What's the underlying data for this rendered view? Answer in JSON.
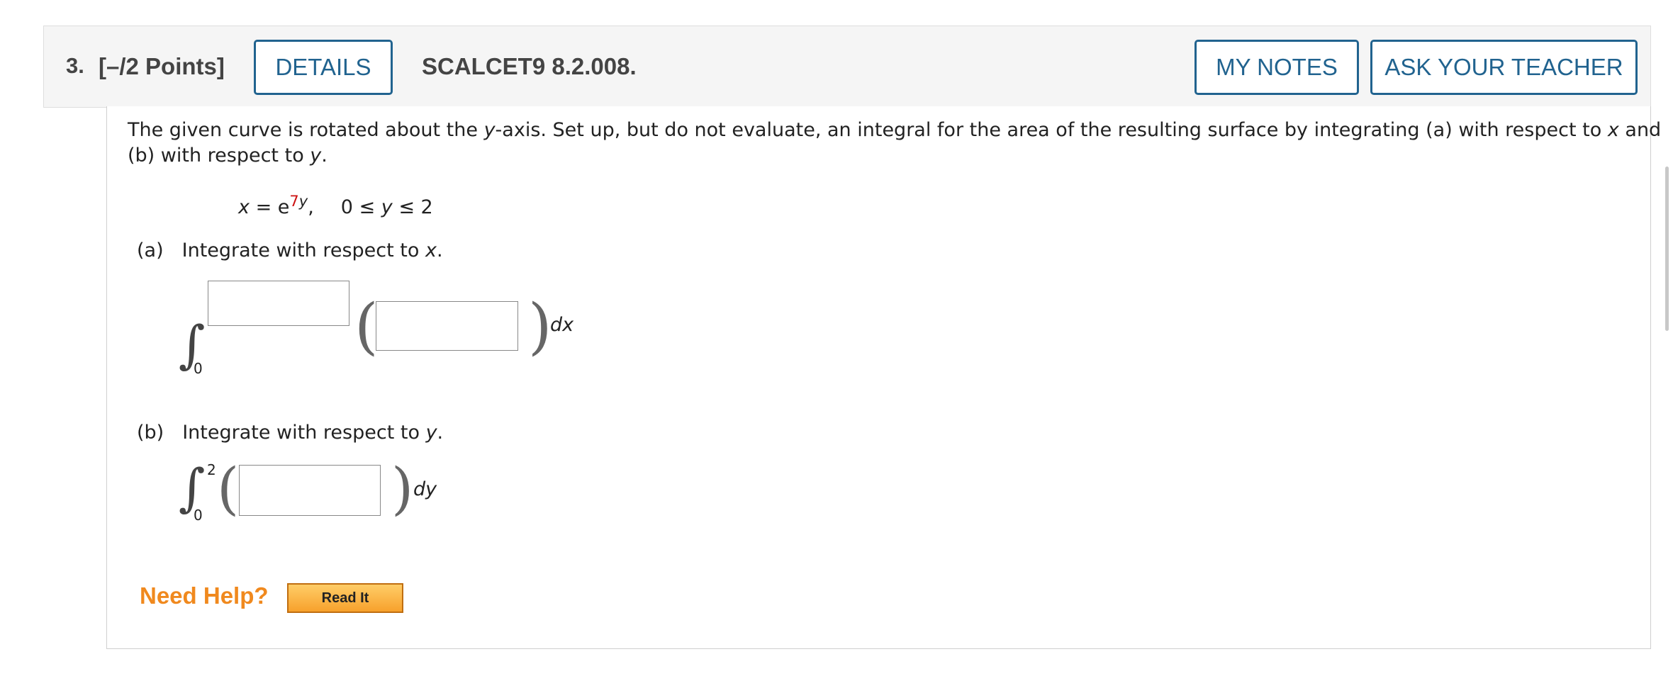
{
  "header": {
    "question_number": "3.",
    "points": "[–/2 Points]",
    "details_label": "DETAILS",
    "code": "SCALCET9 8.2.008.",
    "my_notes_label": "MY NOTES",
    "ask_teacher_label": "ASK YOUR TEACHER"
  },
  "problem": {
    "line1": {
      "p1": "The given curve is rotated about the ",
      "y": "y",
      "p2": "-axis. Set up, but do not evaluate, an integral for the area of the resulting surface by integrating (a) with respect to ",
      "x": "x",
      "p3": " and"
    },
    "line2": {
      "p1": "(b) with respect to ",
      "y": "y",
      "p2": "."
    },
    "equation": {
      "x": "x",
      "eq": " = e",
      "exp_coef": "7",
      "exp_var": "y",
      "comma": ",",
      "range": "0 ≤ ",
      "range_var": "y",
      "range_end": " ≤ 2"
    }
  },
  "part_a": {
    "label": "(a)",
    "text": "Integrate with respect to ",
    "var": "x",
    "period": ".",
    "lower_limit": "0",
    "upper_limit_value": "",
    "integrand_value": "",
    "differential": "dx"
  },
  "part_b": {
    "label": "(b)",
    "text": "Integrate with respect to ",
    "var": "y",
    "period": ".",
    "upper_limit": "2",
    "lower_limit": "0",
    "integrand_value": "",
    "differential": "dy"
  },
  "help": {
    "need_help": "Need Help?",
    "read_it": "Read It"
  }
}
